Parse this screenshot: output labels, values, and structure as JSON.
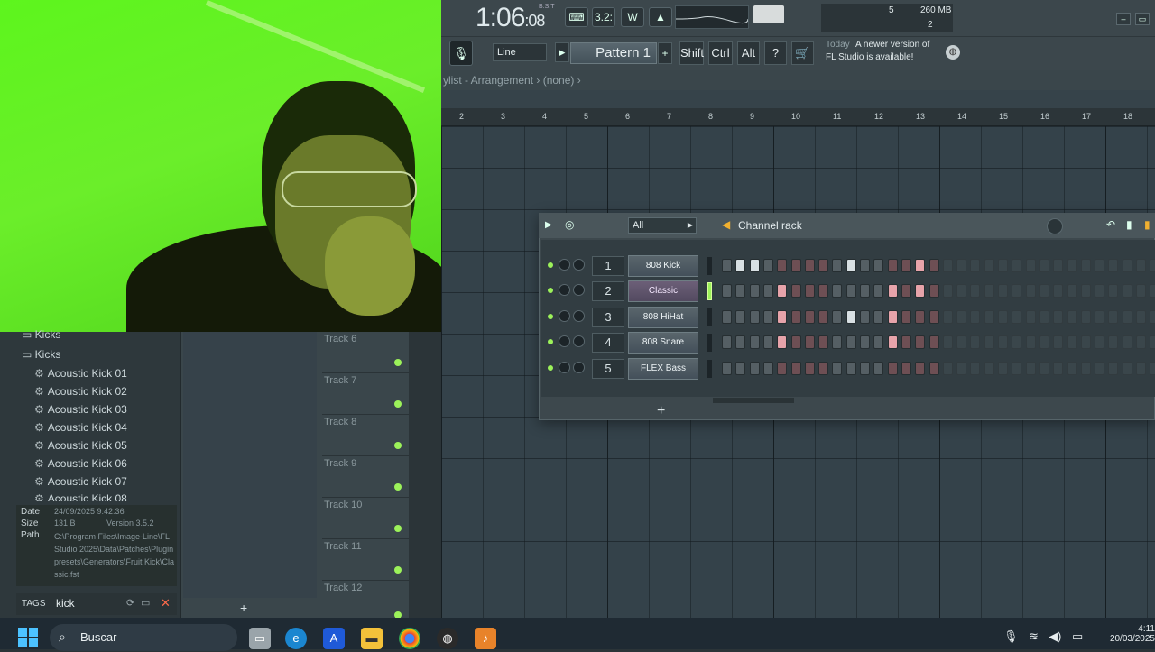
{
  "transport": {
    "time_main": "1:06",
    "time_sub": "08",
    "time_label": "B:S:T",
    "tempo_indicator": "3.2:"
  },
  "system": {
    "memory": "260 MB",
    "cpu": "5",
    "polyphony": "2"
  },
  "toolbar": {
    "input_mode": "Line",
    "pattern": "Pattern 1",
    "add": "+",
    "keys": [
      "Shift",
      "Ctrl",
      "Alt"
    ]
  },
  "news": {
    "date": "Today",
    "message": "A newer version of",
    "message2": "FL Studio is available!"
  },
  "playlist": {
    "title": "ylist - Arrangement  ›  (none)  ›",
    "ruler": [
      "2",
      "3",
      "4",
      "5",
      "6",
      "7",
      "8",
      "9",
      "10",
      "11",
      "12",
      "13",
      "14",
      "15",
      "16",
      "17",
      "18"
    ],
    "tracks": [
      "Track 6",
      "Track 7",
      "Track 8",
      "Track 9",
      "Track 10",
      "Track 11",
      "Track 12"
    ]
  },
  "browser": {
    "folders": [
      "Kicks",
      "Kicks"
    ],
    "items": [
      "Acoustic Kick 01",
      "Acoustic Kick 02",
      "Acoustic Kick 03",
      "Acoustic Kick 04",
      "Acoustic Kick 05",
      "Acoustic Kick 06",
      "Acoustic Kick 07",
      "Acoustic Kick 08"
    ],
    "info": {
      "date_label": "Date",
      "date": "24/09/2025 9:42:36",
      "size_label": "Size",
      "size": "131 B",
      "version": "Version 3.5.2",
      "path_label": "Path",
      "path": "C:\\Program Files\\Image-Line\\FL Studio 2025\\Data\\Patches\\Plugin presets\\Generators\\Fruit Kick\\Classic.fst"
    },
    "tags_label": "TAGS",
    "tags_value": "kick",
    "add": "+"
  },
  "channel_rack": {
    "filter": "All",
    "title": "Channel rack",
    "add": "+",
    "channels": [
      {
        "num": "1",
        "name": "808 Kick",
        "steps": [
          0,
          0,
          0,
          0,
          0,
          0,
          0,
          0,
          0,
          0,
          0,
          0,
          0,
          0,
          0,
          0
        ],
        "highlight": [
          1,
          2,
          9,
          14
        ]
      },
      {
        "num": "2",
        "name": "Classic",
        "steps": [],
        "highlight": [
          4,
          12,
          14
        ]
      },
      {
        "num": "3",
        "name": "808 HiHat",
        "steps": [],
        "highlight": [
          4,
          9,
          12
        ]
      },
      {
        "num": "4",
        "name": "808 Snare",
        "steps": [],
        "highlight": [
          4,
          12
        ]
      },
      {
        "num": "5",
        "name": "FLEX Bass",
        "steps": [],
        "highlight": []
      }
    ]
  },
  "taskbar": {
    "search": "Buscar",
    "time": "4:11",
    "date": "20/03/2025"
  }
}
